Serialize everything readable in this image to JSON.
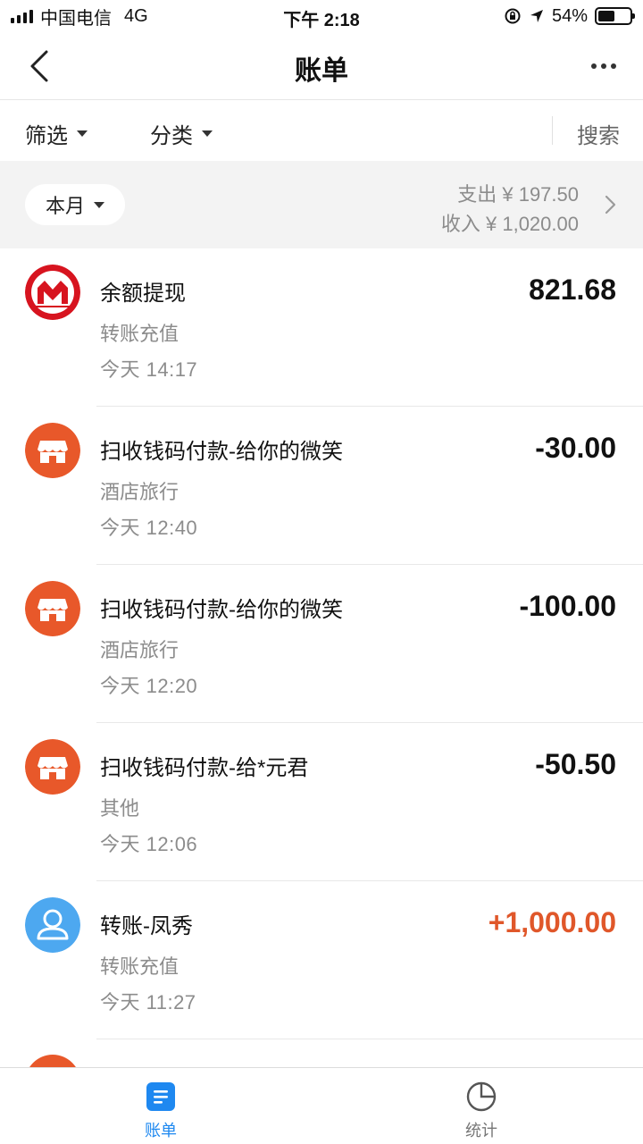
{
  "status_bar": {
    "carrier": "中国电信",
    "network": "4G",
    "time": "下午 2:18",
    "battery": "54%",
    "battery_level": 0.54
  },
  "nav": {
    "title": "账单",
    "back_icon": "chevron-left-icon",
    "more_icon": "more-dots-icon"
  },
  "filters": {
    "filter_label": "筛选",
    "category_label": "分类",
    "search_label": "搜索"
  },
  "summary": {
    "period": "本月",
    "expense": "支出 ¥ 197.50",
    "income": "收入 ¥ 1,020.00"
  },
  "transactions": [
    {
      "title": "余额提现",
      "category": "转账充值",
      "time": "今天  14:17",
      "amount": "821.68",
      "icon": "bank-logo-icon",
      "type": "neutral"
    },
    {
      "title": "扫收钱码付款-给你的微笑",
      "category": "酒店旅行",
      "time": "今天  12:40",
      "amount": "-30.00",
      "icon": "store-icon",
      "type": "expense"
    },
    {
      "title": "扫收钱码付款-给你的微笑",
      "category": "酒店旅行",
      "time": "今天  12:20",
      "amount": "-100.00",
      "icon": "store-icon",
      "type": "expense"
    },
    {
      "title": "扫收钱码付款-给*元君",
      "category": "其他",
      "time": "今天  12:06",
      "amount": "-50.50",
      "icon": "store-icon",
      "type": "expense"
    },
    {
      "title": "转账-凤秀",
      "category": "转账充值",
      "time": "今天  11:27",
      "amount": "+1,000.00",
      "icon": "user-avatar-icon",
      "type": "income"
    }
  ],
  "tabs": [
    {
      "label": "账单",
      "icon": "bill-icon",
      "active": true
    },
    {
      "label": "统计",
      "icon": "pie-chart-icon",
      "active": false
    }
  ],
  "colors": {
    "accent": "#1e88f0",
    "income": "#e0572a",
    "store_icon": "#e8582a",
    "avatar": "#4da8f0",
    "bank_logo": "#d7141f"
  }
}
